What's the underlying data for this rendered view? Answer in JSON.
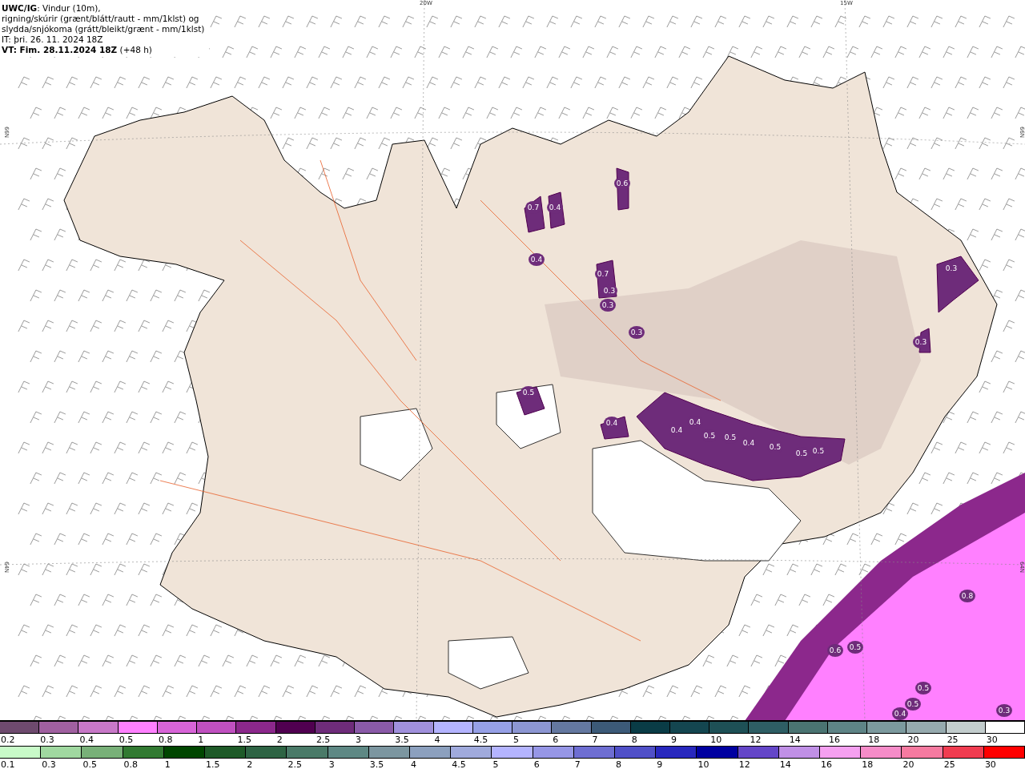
{
  "header": {
    "title": "UWC/IG",
    "title_rest": ": Vindur (10m),",
    "lines": [
      "rigning/skúrir (grænt/blátt/rautt - mm/1klst) og",
      "slydda/snjókoma (grátt/bleikt/grænt - mm/1klst)",
      "IT: þri. 26. 11. 2024 18Z"
    ],
    "valid_time": "VT: Fim. 28.11.2024 18Z",
    "valid_rest": " (+48 h)"
  },
  "grid_labels": [
    "20W",
    "15W",
    "66N",
    "66N",
    "64N",
    "64N"
  ],
  "map_labels": [
    "0.7",
    "0.4",
    "0.6",
    "0.4",
    "0.7",
    "0.3",
    "0.3",
    "0.3",
    "0.5",
    "0.4",
    "0.4",
    "0.4",
    "0.5",
    "0.5",
    "0.4",
    "0.5",
    "0.5",
    "0.5",
    "0.3",
    "0.3",
    "0.8",
    "0.6",
    "0.5",
    "0.5",
    "0.5",
    "0.4",
    "0.3"
  ],
  "legend_snow": [
    {
      "label": "0.2",
      "color": "#6e4a6e"
    },
    {
      "label": "0.3",
      "color": "#a060a0"
    },
    {
      "label": "0.4",
      "color": "#c878c8"
    },
    {
      "label": "0.5",
      "color": "#ff80ff"
    },
    {
      "label": "0.8",
      "color": "#d864d8"
    },
    {
      "label": "1",
      "color": "#c050c0"
    },
    {
      "label": "1.5",
      "color": "#8c288c"
    },
    {
      "label": "2",
      "color": "#500050"
    },
    {
      "label": "2.5",
      "color": "#6e2c7a"
    },
    {
      "label": "3",
      "color": "#8a5aa8"
    },
    {
      "label": "3.5",
      "color": "#a090dc"
    },
    {
      "label": "4",
      "color": "#b4b4ff"
    },
    {
      "label": "4.5",
      "color": "#96a0e6"
    },
    {
      "label": "5",
      "color": "#8c96d2"
    },
    {
      "label": "6",
      "color": "#6478a0"
    },
    {
      "label": "7",
      "color": "#3c5a78"
    },
    {
      "label": "8",
      "color": "#0a3c46"
    },
    {
      "label": "9",
      "color": "#144650"
    },
    {
      "label": "10",
      "color": "#1e5056"
    },
    {
      "label": "12",
      "color": "#2e5e64"
    },
    {
      "label": "14",
      "color": "#4a7472"
    },
    {
      "label": "16",
      "color": "#5e8486"
    },
    {
      "label": "18",
      "color": "#7c9a9e"
    },
    {
      "label": "20",
      "color": "#96aaae"
    },
    {
      "label": "25",
      "color": "#c3cdcd"
    },
    {
      "label": "30",
      "color": "#ffffff"
    }
  ],
  "legend_rain": [
    {
      "label": "0.1",
      "color": "#c8fac8"
    },
    {
      "label": "0.3",
      "color": "#a0d8a0"
    },
    {
      "label": "0.5",
      "color": "#78b078"
    },
    {
      "label": "0.8",
      "color": "#327a32"
    },
    {
      "label": "1",
      "color": "#004600"
    },
    {
      "label": "1.5",
      "color": "#1e5a28"
    },
    {
      "label": "2",
      "color": "#2e6444"
    },
    {
      "label": "2.5",
      "color": "#4a7a68"
    },
    {
      "label": "3",
      "color": "#5e8884"
    },
    {
      "label": "3.5",
      "color": "#7c96a0"
    },
    {
      "label": "4",
      "color": "#8ca0be"
    },
    {
      "label": "4.5",
      "color": "#a0aadc"
    },
    {
      "label": "5",
      "color": "#b4b4ff"
    },
    {
      "label": "6",
      "color": "#9696e6"
    },
    {
      "label": "7",
      "color": "#6e6ed2"
    },
    {
      "label": "8",
      "color": "#5050c8"
    },
    {
      "label": "9",
      "color": "#2828be"
    },
    {
      "label": "10",
      "color": "#0000a0"
    },
    {
      "label": "12",
      "color": "#6446c8"
    },
    {
      "label": "14",
      "color": "#c090e6"
    },
    {
      "label": "16",
      "color": "#f5a0f0"
    },
    {
      "label": "18",
      "color": "#f58cc8"
    },
    {
      "label": "20",
      "color": "#f57aa0"
    },
    {
      "label": "25",
      "color": "#f03c50"
    },
    {
      "label": "30",
      "color": "#ff0000"
    }
  ]
}
